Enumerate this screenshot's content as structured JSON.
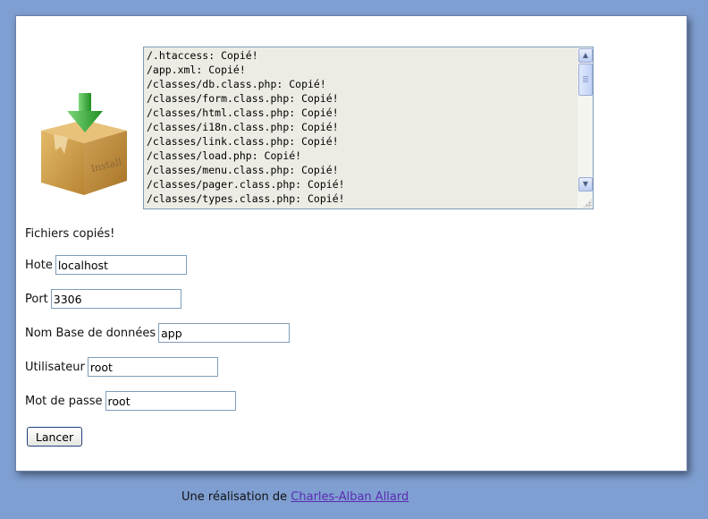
{
  "log": {
    "lines": [
      "/.htaccess: Copié!",
      "/app.xml: Copié!",
      "/classes/db.class.php: Copié!",
      "/classes/form.class.php: Copié!",
      "/classes/html.class.php: Copié!",
      "/classes/i18n.class.php: Copié!",
      "/classes/link.class.php: Copié!",
      "/classes/load.php: Copié!",
      "/classes/menu.class.php: Copié!",
      "/classes/pager.class.php: Copié!",
      "/classes/types.class.php: Copié!"
    ]
  },
  "install_icon": {
    "name": "install-box-icon",
    "label": "Install"
  },
  "status": "Fichiers copiés!",
  "form": {
    "host": {
      "label": "Hote",
      "value": "localhost"
    },
    "port": {
      "label": "Port",
      "value": "3306"
    },
    "database": {
      "label": "Nom Base de données",
      "value": "app"
    },
    "user": {
      "label": "Utilisateur",
      "value": "root"
    },
    "password": {
      "label": "Mot de passe",
      "value": "root"
    },
    "submit_label": "Lancer"
  },
  "footer": {
    "text": "Une réalisation de",
    "author": "Charles-Alban Allard"
  },
  "colors": {
    "background": "#7f9fd2",
    "panel": "#ffffff",
    "link": "#5a2db0",
    "arrow": "#2fae2f",
    "box": "#c99a4a"
  }
}
